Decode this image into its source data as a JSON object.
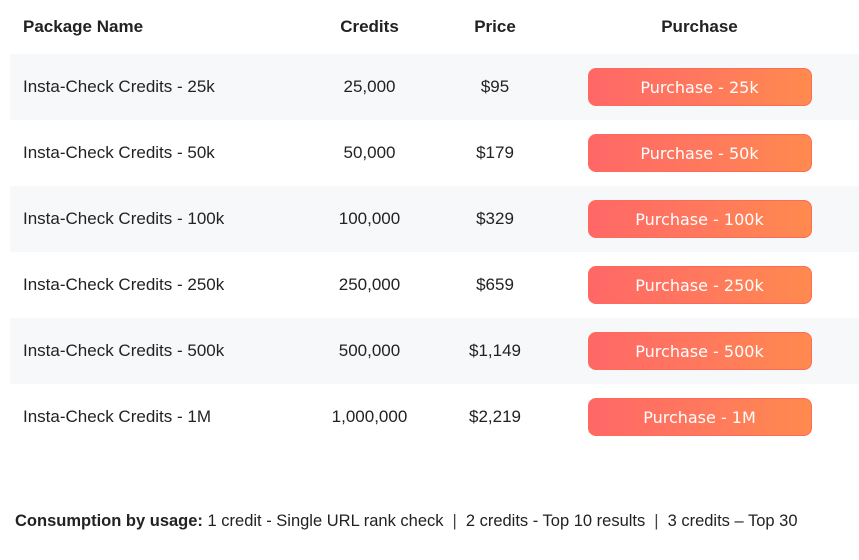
{
  "table": {
    "headers": {
      "name": "Package Name",
      "credits": "Credits",
      "price": "Price",
      "purchase": "Purchase"
    },
    "rows": [
      {
        "name": "Insta-Check Credits - 25k",
        "credits": "25,000",
        "price": "$95",
        "button": "Purchase - 25k"
      },
      {
        "name": "Insta-Check Credits - 50k",
        "credits": "50,000",
        "price": "$179",
        "button": "Purchase - 50k"
      },
      {
        "name": "Insta-Check Credits - 100k",
        "credits": "100,000",
        "price": "$329",
        "button": "Purchase - 100k"
      },
      {
        "name": "Insta-Check Credits - 250k",
        "credits": "250,000",
        "price": "$659",
        "button": "Purchase - 250k"
      },
      {
        "name": "Insta-Check Credits - 500k",
        "credits": "500,000",
        "price": "$1,149",
        "button": "Purchase - 500k"
      },
      {
        "name": "Insta-Check Credits - 1M",
        "credits": "1,000,000",
        "price": "$2,219",
        "button": "Purchase - 1M"
      }
    ]
  },
  "footer": {
    "label": "Consumption by usage:",
    "items": [
      "1 credit - Single URL rank check",
      "2 credits - Top 10 results",
      "3 credits – Top 30"
    ],
    "separator": "|"
  },
  "colors": {
    "button_start": "#ff6767",
    "button_end": "#ff8a4e",
    "row_alt": "#f7f8fa"
  }
}
